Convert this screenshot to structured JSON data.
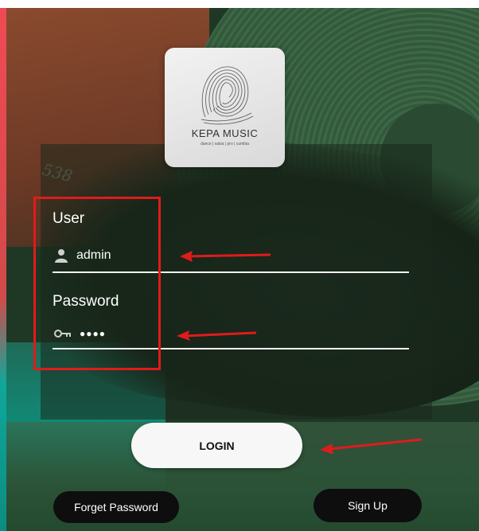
{
  "logo": {
    "name": "KEPA MUSIC",
    "tagline": "dance | salsa | pro | cumbia"
  },
  "form": {
    "user_label": "User",
    "user_value": "admin",
    "password_label": "Password",
    "password_value": "●●●●",
    "user_icon": "user-icon",
    "password_icon": "key-icon"
  },
  "buttons": {
    "login": "LOGIN",
    "forget_password": "Forget Password",
    "sign_up": "Sign Up"
  },
  "colors": {
    "highlight": "#e01b1b",
    "panel": "#19281c",
    "button_light": "#f7f7f7",
    "button_dark": "#0e0e0e"
  },
  "background": {
    "shoe_text": "538"
  }
}
